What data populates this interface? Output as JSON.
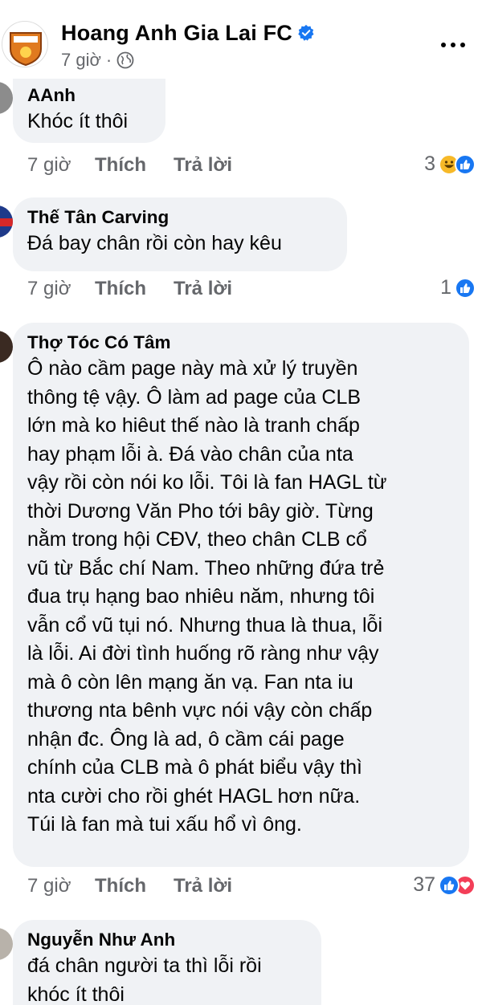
{
  "header": {
    "page_name": "Hoang Anh Gia Lai FC",
    "time": "7 giờ",
    "separator": "·"
  },
  "comments": [
    {
      "author": "AAnh",
      "text": "Khóc ít thôi",
      "time": "7 giờ",
      "like_label": "Thích",
      "reply_label": "Trả lời",
      "reaction_count": "3"
    },
    {
      "author": "Thế Tân Carving",
      "text": "Đá bay chân rồi còn hay kêu",
      "time": "7 giờ",
      "like_label": "Thích",
      "reply_label": "Trả lời",
      "reaction_count": "1"
    },
    {
      "author": "Thợ Tóc Có Tâm",
      "lines": [
        "Ô nào cầm page này mà xử lý truyền",
        "thông tệ vậy. Ô làm ad page của CLB",
        "lớn mà ko hiêut thế nào là tranh chấp",
        "hay phạm lỗi à. Đá vào chân của nta",
        "vậy rồi còn nói ko lỗi. Tôi là fan HAGL từ",
        "thời Dương Văn Pho tới bây giờ. Từng",
        "nằm trong hội CĐV, theo chân CLB cổ",
        "vũ từ Bắc chí Nam. Theo những đứa trẻ",
        "đua trụ hạng bao nhiêu năm, nhưng tôi",
        "vẫn cổ vũ tụi nó. Nhưng thua là thua, lỗi",
        "là lỗi. Ai đời tình huống rõ ràng như vậy",
        "mà ô còn lên mạng ăn vạ. Fan nta iu",
        "thương nta bênh vực nói vậy còn chấp",
        "nhận đc. Ông là ad, ô cầm cái page",
        "chính của CLB mà ô phát biểu vậy thì",
        "nta cười cho rồi ghét HAGL hơn nữa.",
        "Túi là fan mà tui xấu hổ vì ông."
      ],
      "time": "7 giờ",
      "like_label": "Thích",
      "reply_label": "Trả lời",
      "reaction_count": "37"
    },
    {
      "author": "Nguyễn Như Anh",
      "lines": [
        "đá chân người ta thì lỗi rồi",
        "khóc ít thôi"
      ]
    }
  ],
  "colors": {
    "bubble": "#f0f2f5",
    "secondary_text": "#65676b",
    "like_blue": "#1877f2",
    "love_red": "#f33e58",
    "haha_yellow": "#f7b928"
  }
}
